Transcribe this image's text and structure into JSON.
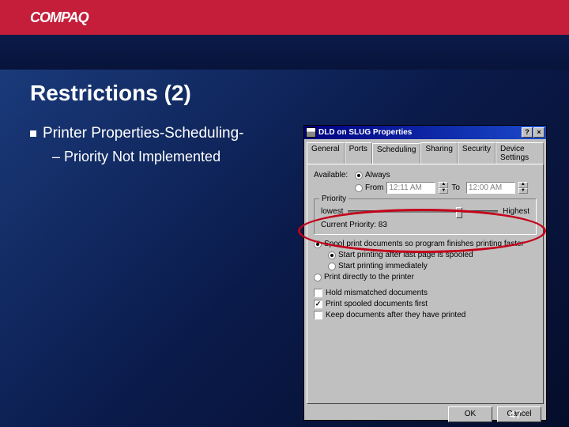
{
  "brand": "COMPAQ",
  "slide": {
    "title": "Restrictions (2)",
    "bullet1": "Printer Properties-Scheduling-",
    "bullet2": "– Priority Not Implemented",
    "page_number": "47"
  },
  "dialog": {
    "title": "DLD on SLUG Properties",
    "help_btn": "?",
    "close_btn": "×",
    "tabs": {
      "general": "General",
      "ports": "Ports",
      "scheduling": "Scheduling",
      "sharing": "Sharing",
      "security": "Security",
      "device": "Device Settings"
    },
    "available_label": "Available:",
    "opt_always": "Always",
    "opt_from": "From",
    "time_from": "12:11 AM",
    "to_label": "To",
    "time_to": "12:00 AM",
    "priority_group": "Priority",
    "lowest": "lowest",
    "highest": "Highest",
    "current_priority": "Current Priority: 83",
    "spool_opt": "Spool print documents so program finishes printing faster",
    "spool_last": "Start printing after last page is spooled",
    "spool_immediate": "Start printing immediately",
    "direct_opt": "Print directly to the printer",
    "hold_mismatch": "Hold mismatched documents",
    "print_first": "Print spooled documents first",
    "keep_docs": "Keep documents after they have printed",
    "ok": "OK",
    "cancel": "Cancel"
  }
}
